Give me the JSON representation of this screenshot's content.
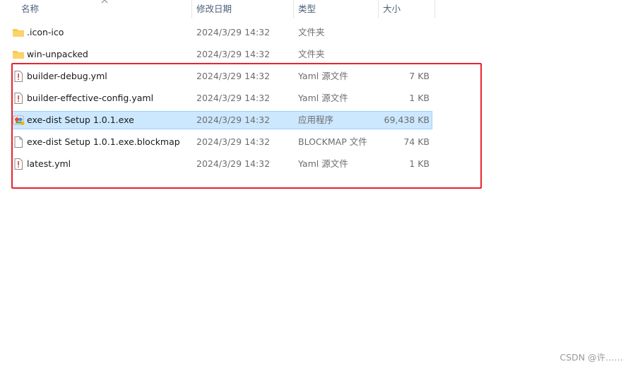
{
  "columns": {
    "name": "名称",
    "modified": "修改日期",
    "type": "类型",
    "size": "大小"
  },
  "files": [
    {
      "name": ".icon-ico",
      "modified": "2024/3/29 14:32",
      "type": "文件夹",
      "size": "",
      "icon": "folder-icon"
    },
    {
      "name": "win-unpacked",
      "modified": "2024/3/29 14:32",
      "type": "文件夹",
      "size": "",
      "icon": "folder-icon"
    },
    {
      "name": "builder-debug.yml",
      "modified": "2024/3/29 14:32",
      "type": "Yaml 源文件",
      "size": "7 KB",
      "icon": "yaml-file-icon"
    },
    {
      "name": "builder-effective-config.yaml",
      "modified": "2024/3/29 14:32",
      "type": "Yaml 源文件",
      "size": "1 KB",
      "icon": "yaml-file-icon"
    },
    {
      "name": "exe-dist Setup 1.0.1.exe",
      "modified": "2024/3/29 14:32",
      "type": "应用程序",
      "size": "69,438 KB",
      "icon": "installer-exe-icon",
      "selected": true
    },
    {
      "name": "exe-dist Setup 1.0.1.exe.blockmap",
      "modified": "2024/3/29 14:32",
      "type": "BLOCKMAP 文件",
      "size": "74 KB",
      "icon": "blank-file-icon"
    },
    {
      "name": "latest.yml",
      "modified": "2024/3/29 14:32",
      "type": "Yaml 源文件",
      "size": "1 KB",
      "icon": "yaml-file-icon"
    }
  ],
  "watermark": "CSDN @许……",
  "colors": {
    "highlight_box": "#e8232a",
    "selection_bg": "#cce8ff",
    "selection_border": "#99d1ff",
    "folder": "#f8c74d"
  }
}
